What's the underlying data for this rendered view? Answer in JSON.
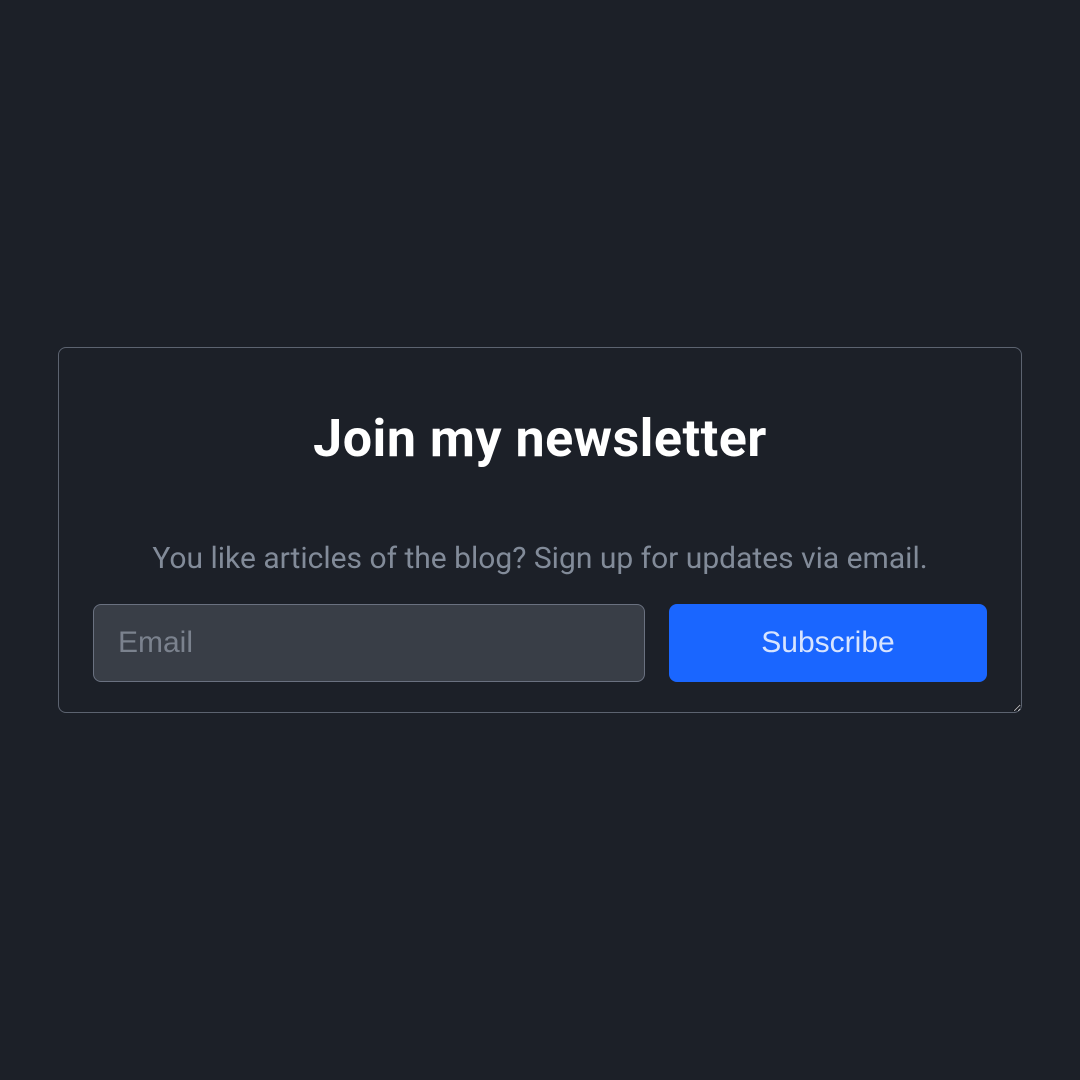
{
  "newsletter": {
    "title": "Join my newsletter",
    "description": "You like articles of the blog? Sign up for updates via email.",
    "email_placeholder": "Email",
    "email_value": "",
    "subscribe_label": "Subscribe"
  }
}
